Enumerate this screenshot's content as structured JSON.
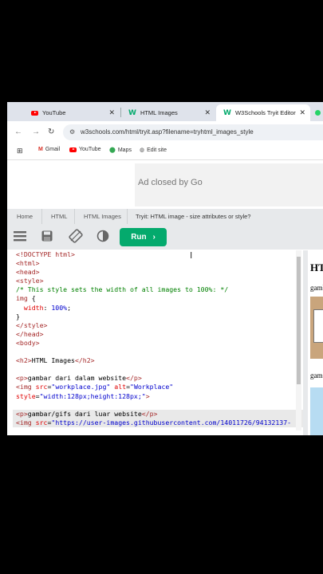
{
  "tabs": [
    {
      "label": "YouTube",
      "icon": "youtube-icon"
    },
    {
      "label": "HTML Images",
      "icon": "w3schools-icon"
    },
    {
      "label": "W3Schools Tryit Editor",
      "icon": "w3schools-icon",
      "active": true
    }
  ],
  "address": {
    "url": "w3schools.com/html/tryit.asp?filename=tryhtml_images_style"
  },
  "bookmarks": [
    {
      "label": "Gmail",
      "icon": "gmail-icon"
    },
    {
      "label": "YouTube",
      "icon": "youtube-icon"
    },
    {
      "label": "Maps",
      "icon": "maps-icon"
    },
    {
      "label": "Edit site",
      "icon": "globe-icon"
    }
  ],
  "ad": {
    "text": "Ad closed by Go"
  },
  "breadcrumb": {
    "home": "Home",
    "html": "HTML",
    "images": "HTML Images",
    "current": "Tryit: HTML image - size attributes or style?"
  },
  "toolbar": {
    "run_label": "Run"
  },
  "result": {
    "heading": "HT",
    "p1": "gamb",
    "p2": "gam"
  },
  "colors": {
    "accent": "#04aa6d",
    "code_tag": "#a52a2a",
    "code_attr": "#e00000",
    "code_string": "#0000cd",
    "code_comment": "#008000"
  },
  "code_lines": [
    "<!DOCTYPE html>",
    "<html>",
    "<head>",
    "<style>",
    "/* This style sets the width of all images to 100%: */",
    "img {",
    "  width: 100%;",
    "}",
    "</style>",
    "</head>",
    "<body>",
    "",
    "<h2>HTML Images</h2>",
    "",
    "<p>gambar dari dalam website</p>",
    "<img src=\"workplace.jpg\" alt=\"Workplace\"",
    "style=\"width:128px;height:128px;\">",
    "",
    "<p>gambar/gifs dari luar website</p>",
    "<img src=\"https://user-images.githubusercontent.com/14011726/94132137-"
  ]
}
